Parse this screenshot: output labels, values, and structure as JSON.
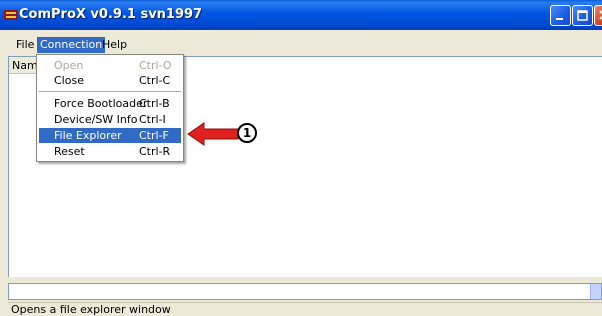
{
  "window": {
    "title": "ComProX v0.9.1 svn1997"
  },
  "menubar": {
    "items": [
      {
        "label": "File"
      },
      {
        "label": "Connection"
      },
      {
        "label": "Help"
      }
    ]
  },
  "listview": {
    "column_header": "Name"
  },
  "connection_menu": {
    "items": [
      {
        "label": "Open",
        "accel": "Ctrl-O",
        "enabled": false
      },
      {
        "label": "Close",
        "accel": "Ctrl-C",
        "enabled": true
      },
      {
        "label": "Force Bootloader",
        "accel": "Ctrl-B",
        "enabled": true
      },
      {
        "label": "Device/SW Info",
        "accel": "Ctrl-I",
        "enabled": true
      },
      {
        "label": "File Explorer",
        "accel": "Ctrl-F",
        "enabled": true,
        "selected": true
      },
      {
        "label": "Reset",
        "accel": "Ctrl-R",
        "enabled": true
      }
    ]
  },
  "annotation": {
    "number": "1",
    "arrow_color": "#e0211f"
  },
  "statusbar": {
    "text": "Opens a file explorer window"
  },
  "colors": {
    "titlebar": "#0054e3",
    "selection": "#316ac5",
    "close_button": "#d5462b"
  }
}
